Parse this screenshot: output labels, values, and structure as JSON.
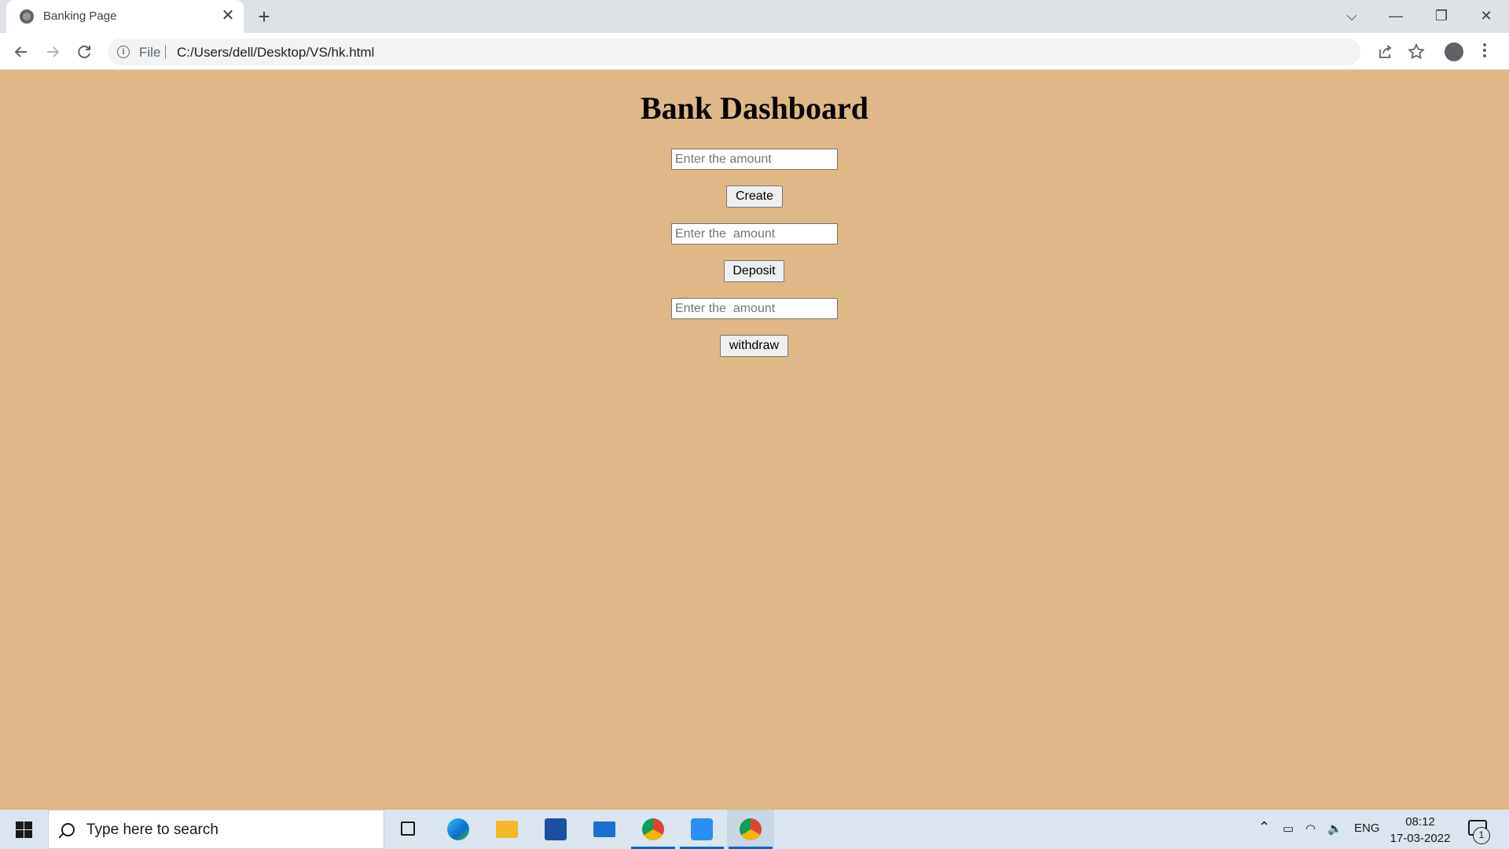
{
  "browser": {
    "tab_title": "Banking Page",
    "tab_close": "✕",
    "new_tab": "+",
    "scheme_label": "File",
    "url": "C:/Users/dell/Desktop/VS/hk.html",
    "window_controls": [
      "⌵",
      "—",
      "❐",
      "✕"
    ]
  },
  "page": {
    "background": "#deb887",
    "title": "Bank Dashboard",
    "forms": [
      {
        "input_placeholder": "Enter the amount",
        "input_value": "",
        "button_label": "Create"
      },
      {
        "input_placeholder": "Enter the  amount",
        "input_value": "",
        "button_label": "Deposit"
      },
      {
        "input_placeholder": "Enter the  amount",
        "input_value": "",
        "button_label": "withdraw"
      }
    ]
  },
  "taskbar": {
    "search_placeholder": "Type here to search",
    "apps": [
      "task-view",
      "edge",
      "file-explorer",
      "microsoft-store",
      "mail",
      "chrome-profile",
      "vs-code",
      "chrome"
    ],
    "tray": {
      "language": "ENG",
      "time": "08:12",
      "date": "17-03-2022",
      "notification_count": "1"
    }
  },
  "colors": {
    "accent": "#0067c0",
    "page_bg": "#deb887",
    "taskbar_bg": "#dae5ef"
  }
}
